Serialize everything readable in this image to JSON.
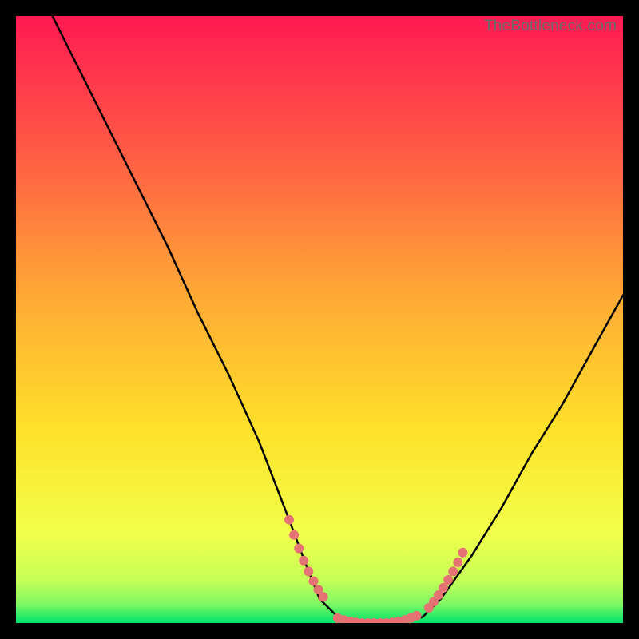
{
  "watermark": "TheBottleneck.com",
  "colors": {
    "gradient_top": "#ff1a52",
    "gradient_mid_upper": "#ff7a3a",
    "gradient_mid": "#ffd200",
    "gradient_mid_lower": "#f4ff3a",
    "gradient_bottom": "#00e36b",
    "curve": "#000000",
    "dots": "#e57373",
    "frame": "#000000"
  },
  "chart_data": {
    "type": "line",
    "title": "",
    "xlabel": "",
    "ylabel": "",
    "xlim": [
      0,
      100
    ],
    "ylim": [
      0,
      100
    ],
    "note": "Axes are unlabeled percentages; values estimated from pixel positions of the curve. y=0 at bottom (green), y=100 at top (red).",
    "series": [
      {
        "name": "bottleneck-curve",
        "x": [
          6,
          10,
          15,
          20,
          25,
          30,
          35,
          40,
          45,
          48,
          50,
          53,
          56,
          60,
          63,
          67,
          70,
          75,
          80,
          85,
          90,
          95,
          100
        ],
        "y": [
          100,
          92,
          82,
          72,
          62,
          51,
          41,
          30,
          17,
          9,
          4,
          1,
          0,
          0,
          0,
          1,
          4,
          11,
          19,
          28,
          36,
          45,
          54
        ]
      }
    ],
    "highlight_dots": {
      "name": "highlighted-range",
      "left_cluster": {
        "x": [
          45.0,
          45.8,
          46.6,
          47.4,
          48.2,
          49.0,
          49.8,
          50.6
        ],
        "y": [
          17.0,
          14.5,
          12.3,
          10.3,
          8.5,
          6.9,
          5.5,
          4.3
        ]
      },
      "bottom_cluster": {
        "x": [
          53,
          54,
          55,
          56,
          57,
          58,
          59,
          60,
          61,
          62,
          63,
          64,
          65,
          66
        ],
        "y": [
          0.8,
          0.5,
          0.3,
          0.1,
          0.0,
          0.0,
          0.0,
          0.0,
          0.0,
          0.1,
          0.3,
          0.5,
          0.8,
          1.2
        ]
      },
      "right_cluster": {
        "x": [
          68.0,
          68.8,
          69.6,
          70.4,
          71.2,
          72.0,
          72.8,
          73.6
        ],
        "y": [
          2.5,
          3.5,
          4.6,
          5.8,
          7.1,
          8.5,
          10.0,
          11.6
        ]
      }
    }
  }
}
